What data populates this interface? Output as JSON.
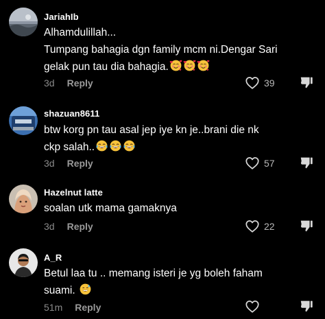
{
  "colors": {
    "background": "#000000",
    "text": "#ffffff",
    "meta": "#8a8a8a",
    "icon": "#cfcfcf"
  },
  "comments": [
    {
      "username": "JariahIb",
      "lines": [
        "Alhamdulillah...",
        "Tumpang bahagia dgn family mcm ni.Dengar Sari",
        "gelak pun tau dia bahagia."
      ],
      "emojis": [
        "smiling-face-with-hearts",
        "smiling-face-with-hearts",
        "smiling-face-with-hearts"
      ],
      "time": "3d",
      "reply_label": "Reply",
      "likes": "39"
    },
    {
      "username": "shazuan8611",
      "lines": [
        "btw korg pn tau asal jep iye kn je..brani die nk",
        "ckp salah.."
      ],
      "emojis": [
        "face-with-tears-of-joy",
        "face-with-tears-of-joy",
        "face-with-tears-of-joy"
      ],
      "time": "3d",
      "reply_label": "Reply",
      "likes": "57"
    },
    {
      "username": "Hazelnut latte",
      "lines": [
        "soalan utk mama gamaknya"
      ],
      "emojis": [],
      "time": "3d",
      "reply_label": "Reply",
      "likes": "22"
    },
    {
      "username": "A_R",
      "lines": [
        "Betul laa tu .. memang isteri je yg boleh faham",
        "suami. "
      ],
      "emojis": [
        "grinning-face-with-sweat"
      ],
      "time": "51m",
      "reply_label": "Reply",
      "likes": ""
    }
  ]
}
